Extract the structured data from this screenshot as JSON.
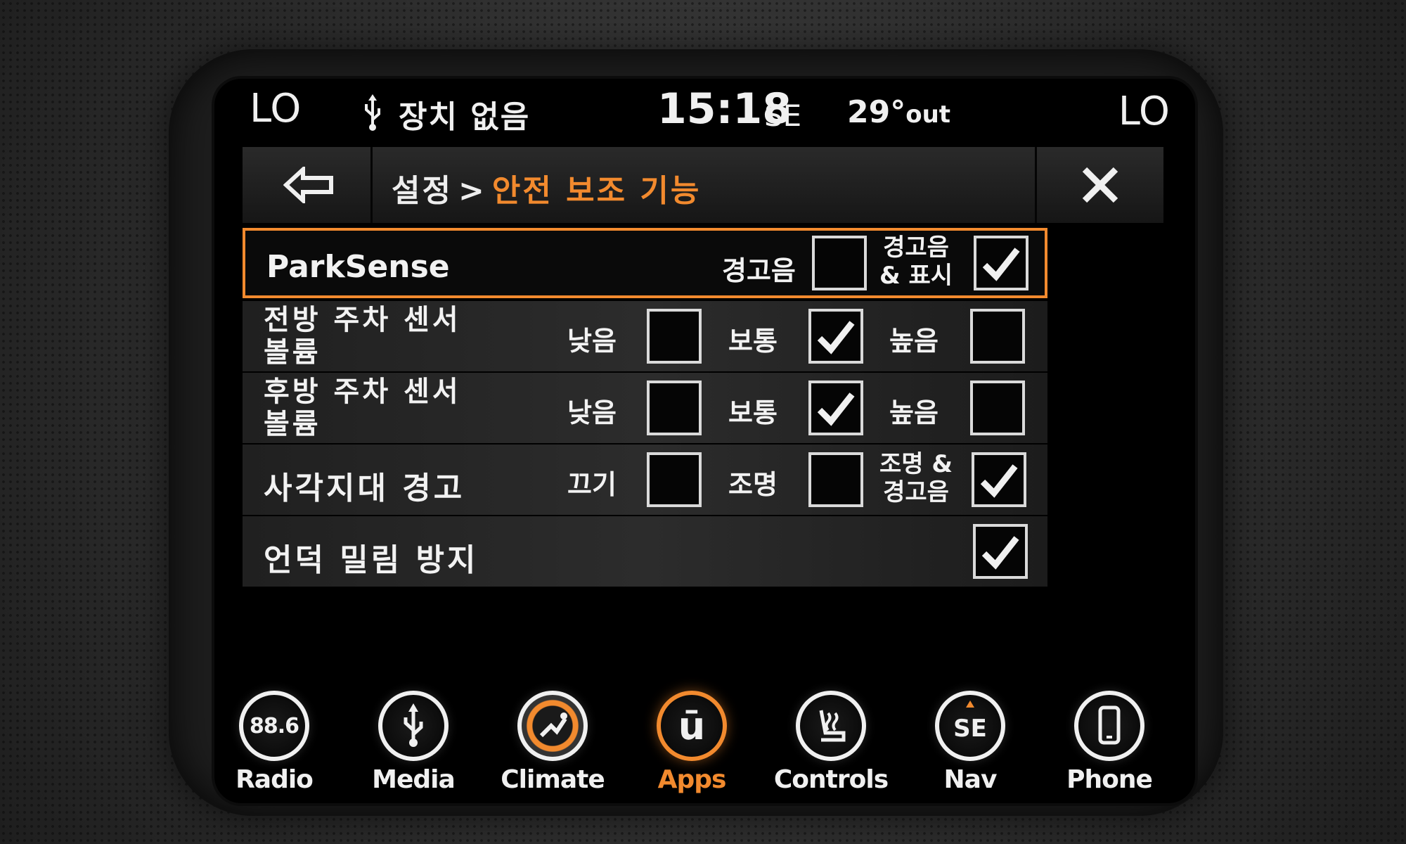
{
  "status": {
    "climate_left": "LO",
    "climate_right": "LO",
    "device": "장치 없음",
    "time": "15:18",
    "compass": "SE",
    "temperature": "29°",
    "temperature_suffix": "out"
  },
  "header": {
    "breadcrumb_root": "설정",
    "breadcrumb_separator": ">",
    "breadcrumb_current": "안전 보조 기능"
  },
  "rows": {
    "parksense": {
      "title": "ParkSense",
      "opt1_label": "경고음",
      "opt1_checked": false,
      "opt2_label_line1": "경고음",
      "opt2_label_line2": "& 표시",
      "opt2_checked": true
    },
    "front_volume": {
      "title_line1": "전방 주차 센서",
      "title_line2": "볼륨",
      "low": "낮음",
      "low_checked": false,
      "normal": "보통",
      "normal_checked": true,
      "high": "높음",
      "high_checked": false
    },
    "rear_volume": {
      "title_line1": "후방 주차 센서",
      "title_line2": "볼륨",
      "low": "낮음",
      "low_checked": false,
      "normal": "보통",
      "normal_checked": true,
      "high": "높음",
      "high_checked": false
    },
    "blind_spot": {
      "title": "사각지대 경고",
      "off": "끄기",
      "off_checked": false,
      "lights": "조명",
      "lights_checked": false,
      "lights_chime_line1": "조명 &",
      "lights_chime_line2": "경고음",
      "lights_chime_checked": true
    },
    "hill_start": {
      "title": "언덕 밀림 방지",
      "checked": true
    }
  },
  "nav": {
    "items": [
      {
        "label": "Radio",
        "icon": "radio-icon",
        "icon_text": "88.6",
        "active": false
      },
      {
        "label": "Media",
        "icon": "usb-icon",
        "active": false
      },
      {
        "label": "Climate",
        "icon": "climate-icon",
        "active": false
      },
      {
        "label": "Apps",
        "icon": "apps-icon",
        "icon_text": "ū",
        "active": true
      },
      {
        "label": "Controls",
        "icon": "controls-icon",
        "active": false
      },
      {
        "label": "Nav",
        "icon": "compass-icon",
        "icon_text": "SE",
        "active": false
      },
      {
        "label": "Phone",
        "icon": "phone-icon",
        "active": false
      }
    ]
  },
  "colors": {
    "accent": "#f28a2e",
    "text": "#f0f0f0",
    "background": "#000000"
  }
}
